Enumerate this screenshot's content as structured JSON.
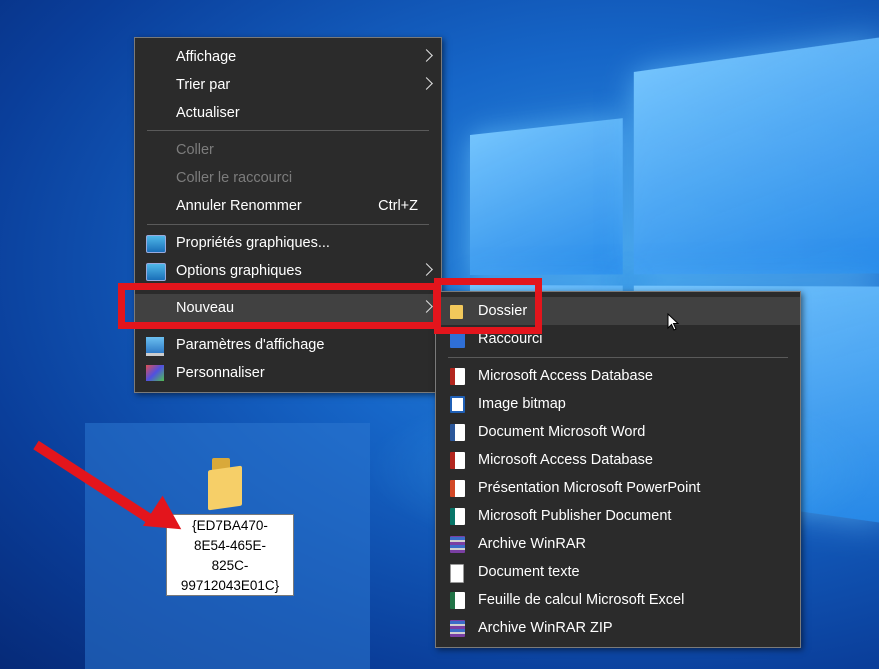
{
  "main_menu": {
    "items": [
      {
        "label": "Affichage",
        "submenu": true
      },
      {
        "label": "Trier par",
        "submenu": true
      },
      {
        "label": "Actualiser"
      },
      {
        "label": "Coller",
        "disabled": true
      },
      {
        "label": "Coller le raccourci",
        "disabled": true
      },
      {
        "label": "Annuler Renommer",
        "shortcut": "Ctrl+Z"
      },
      {
        "label": "Propriétés graphiques...",
        "icon": "graphics-properties-icon"
      },
      {
        "label": "Options graphiques",
        "submenu": true,
        "icon": "graphics-options-icon"
      },
      {
        "label": "Nouveau",
        "submenu": true,
        "highlighted": true
      },
      {
        "label": "Paramètres d'affichage",
        "icon": "display-settings-icon"
      },
      {
        "label": "Personnaliser",
        "icon": "personalize-icon"
      }
    ]
  },
  "new_submenu": {
    "items": [
      {
        "label": "Dossier",
        "icon": "folder-icon",
        "hover": true
      },
      {
        "label": "Raccourci",
        "icon": "shortcut-icon"
      },
      {
        "label": "Microsoft Access Database",
        "icon": "access-icon"
      },
      {
        "label": "Image bitmap",
        "icon": "bitmap-icon"
      },
      {
        "label": "Document Microsoft Word",
        "icon": "word-icon"
      },
      {
        "label": "Microsoft Access Database",
        "icon": "access-icon"
      },
      {
        "label": "Présentation Microsoft PowerPoint",
        "icon": "powerpoint-icon"
      },
      {
        "label": "Microsoft Publisher Document",
        "icon": "publisher-icon"
      },
      {
        "label": "Archive WinRAR",
        "icon": "winrar-icon"
      },
      {
        "label": "Document texte",
        "icon": "text-document-icon"
      },
      {
        "label": "Feuille de calcul Microsoft Excel",
        "icon": "excel-icon"
      },
      {
        "label": "Archive WinRAR ZIP",
        "icon": "winrar-zip-icon"
      }
    ]
  },
  "desktop_item": {
    "rename_lines": [
      "{ED7BA470-",
      "8E54-465E-",
      "825C-",
      "99712043E01C}"
    ]
  },
  "colors": {
    "menu_bg": "#2b2b2b",
    "highlight_red": "#e3151c",
    "desktop_blue": "#1666c8"
  }
}
